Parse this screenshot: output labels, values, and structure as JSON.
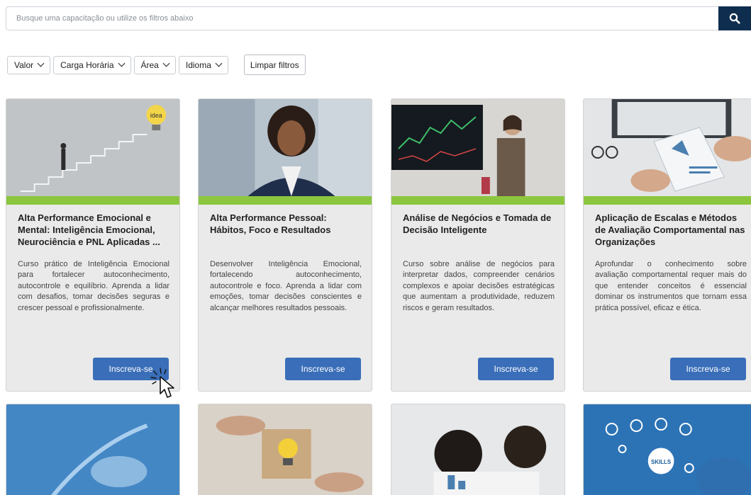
{
  "search": {
    "placeholder": "Busque uma capacitação ou utilize os filtros abaixo",
    "value": ""
  },
  "filters": {
    "items": [
      {
        "label": "Valor"
      },
      {
        "label": "Carga Horária"
      },
      {
        "label": "Área"
      },
      {
        "label": "Idioma"
      }
    ],
    "clear_label": "Limpar filtros"
  },
  "courses": [
    {
      "title": "Alta Performance Emocional e Mental: Inteligência Emocional, Neurociência e PNL Aplicadas ...",
      "description": "Curso prático de Inteligência Emocional para fortalecer autoconhecimento, autocontrole e equilíbrio. Aprenda a lidar com desafios, tomar decisões seguras e crescer pessoal e profissionalmente.",
      "button": "Inscreva-se"
    },
    {
      "title": "Alta Performance Pessoal: Hábitos, Foco e Resultados",
      "description": "Desenvolver Inteligência Emocional, fortalecendo autoconhecimento, autocontrole e foco. Aprenda a lidar com emoções, tomar decisões conscientes e alcançar melhores resultados pessoais.",
      "button": "Inscreva-se"
    },
    {
      "title": "Análise de Negócios e Tomada de Decisão Inteligente",
      "description": "Curso sobre análise de negócios para interpretar dados, compreender cenários complexos e apoiar decisões estratégicas que aumentam a produtividade, reduzem riscos e geram resultados.",
      "button": "Inscreva-se"
    },
    {
      "title": "Aplicação de Escalas e Métodos de Avaliação Comportamental nas Organizações",
      "description": "Aprofundar o conhecimento sobre avaliação comportamental requer mais do que entender conceitos é essencial dominar os instrumentos que tornam essa prática possível, eficaz e ética.",
      "button": "Inscreva-se"
    }
  ],
  "image_labels": {
    "idea": "idea",
    "skills": "SKILLS"
  },
  "colors": {
    "search_button": "#0f2e4f",
    "accent_bar": "#8cc63f",
    "primary_button": "#3a6eb8",
    "card_background": "#eaeaea"
  }
}
